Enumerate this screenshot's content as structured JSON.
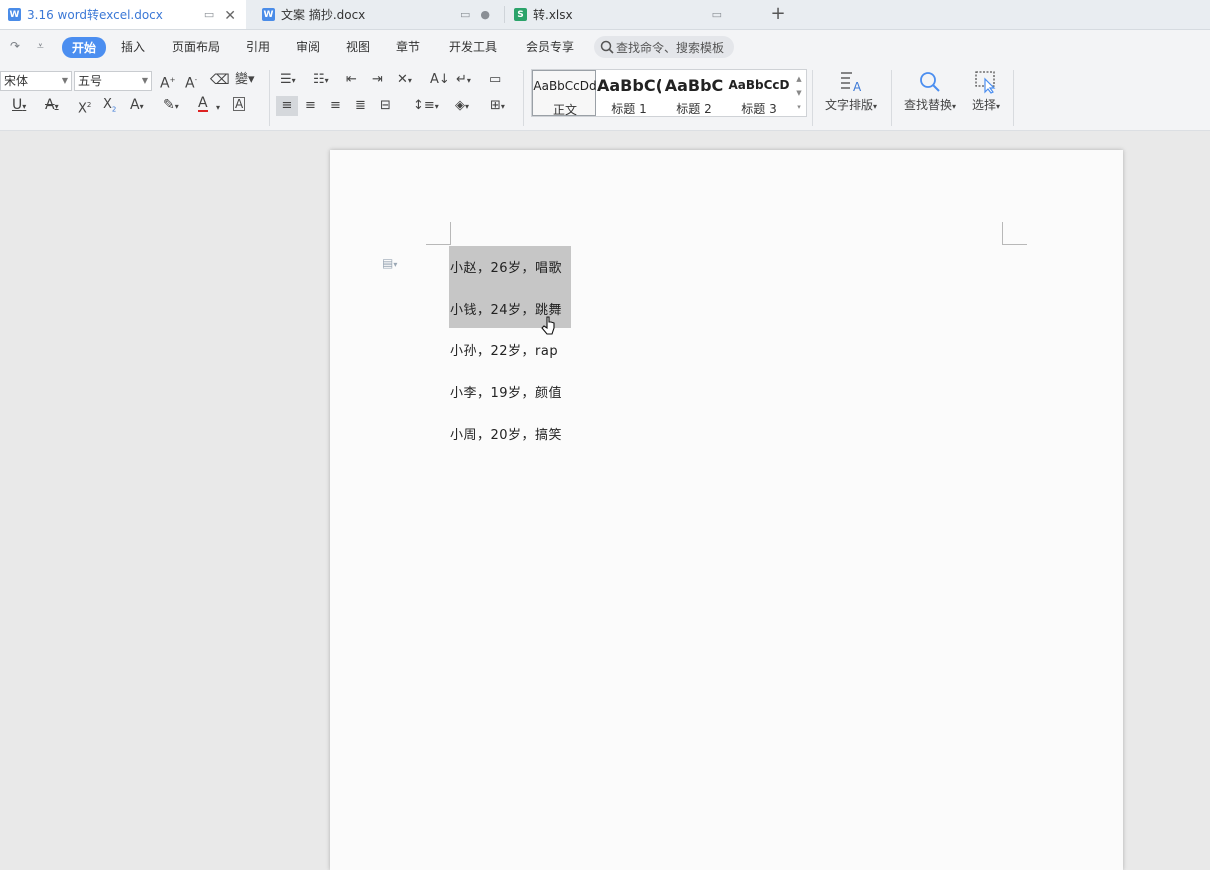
{
  "tabs": [
    {
      "label": "3.16 word转excel.docx",
      "type": "W"
    },
    {
      "label": "文案 摘抄.docx",
      "type": "W"
    },
    {
      "label": "转.xlsx",
      "type": "S"
    }
  ],
  "new_tab_label": "+",
  "menu": {
    "items": [
      "开始",
      "插入",
      "页面布局",
      "引用",
      "审阅",
      "视图",
      "章节",
      "开发工具",
      "会员专享"
    ],
    "search_placeholder": "查找命令、搜索模板"
  },
  "ribbon": {
    "font_name": "宋体",
    "font_size": "五号",
    "styles": [
      {
        "sample": "AaBbCcDd",
        "name": "正文"
      },
      {
        "sample": "AaBbC(",
        "name": "标题 1"
      },
      {
        "sample": "AaBbC",
        "name": "标题 2"
      },
      {
        "sample": "AaBbCcD",
        "name": "标题 3"
      }
    ],
    "text_layout_label": "文字排版",
    "find_replace_label": "查找替换",
    "select_label": "选择"
  },
  "document": {
    "lines": [
      "小赵，26岁，唱歌",
      "小钱，24岁，跳舞",
      "小孙，22岁，rap",
      "小李，19岁，颜值",
      "小周，20岁，搞笑"
    ],
    "selected_line_count": 2
  },
  "colors": {
    "accent": "#4b8ef0",
    "word_icon": "#4a8ce8",
    "sheet_icon": "#2ba36a",
    "selection": "#c6c6c6"
  }
}
